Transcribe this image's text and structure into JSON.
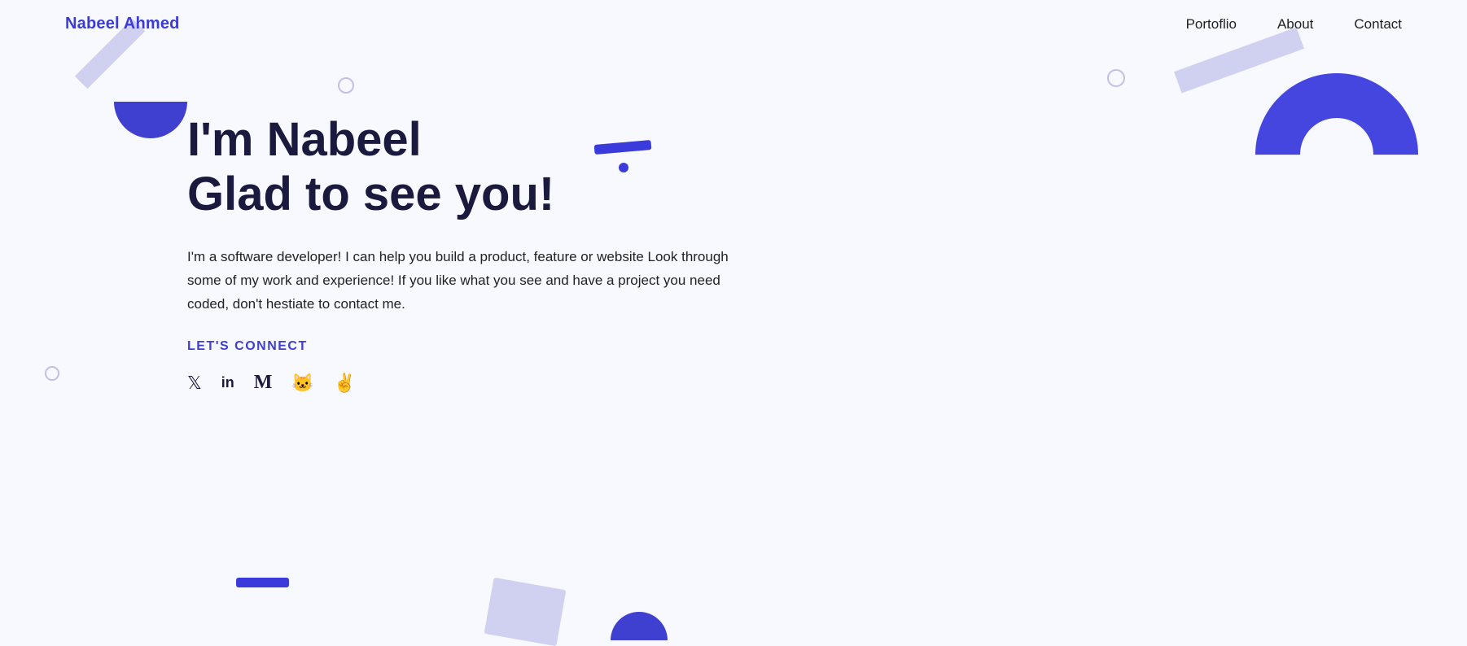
{
  "nav": {
    "brand": "Nabeel Ahmed",
    "links": [
      {
        "label": "Portoflio",
        "href": "#"
      },
      {
        "label": "About",
        "href": "#"
      },
      {
        "label": "Contact",
        "href": "#"
      }
    ]
  },
  "hero": {
    "title_line1": "I'm Nabeel",
    "title_line2": "Glad to see you!",
    "description": "I'm a software developer! I can help you build a product, feature or website Look through some of my work and experience! If you like what you see and have a project you need coded, don't hestiate to contact me.",
    "cta_label": "LET'S CONNECT"
  },
  "social_icons": [
    {
      "name": "twitter",
      "label": "Twitter"
    },
    {
      "name": "linkedin",
      "label": "LinkedIn"
    },
    {
      "name": "medium",
      "label": "Medium"
    },
    {
      "name": "github",
      "label": "GitHub"
    },
    {
      "name": "devto",
      "label": "Dev.to"
    }
  ],
  "colors": {
    "brand_blue": "#3b3bdb",
    "dark_text": "#1a1a3e",
    "bg": "#f8f8ff",
    "shape_light": "#d0d0f0",
    "shape_dark": "#4040d0"
  }
}
